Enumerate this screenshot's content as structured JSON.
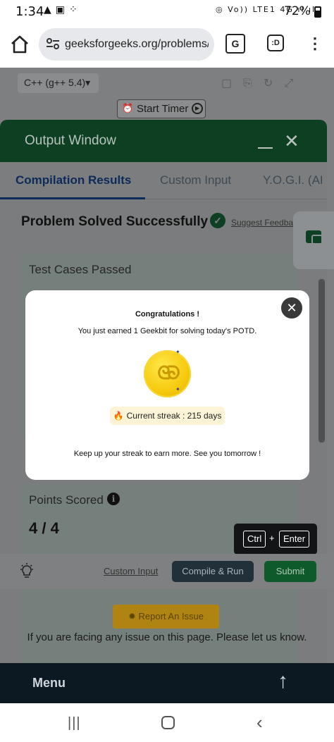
{
  "status_bar": {
    "time": "1:34",
    "battery": "72%",
    "net_label": "Vo)) LTE1 4G"
  },
  "browser": {
    "url": "geeksforgeeks.org/problems/ac",
    "tabs_label": ":D"
  },
  "editor": {
    "language": "C++ (g++ 5.4)▾",
    "timer_label": "Start Timer"
  },
  "output_window": {
    "title": "Output Window",
    "tabs": [
      {
        "label": "Compilation Results"
      },
      {
        "label": "Custom Input"
      },
      {
        "label": "Y.O.G.I. (AI B"
      }
    ],
    "status_title": "Problem Solved Successfully",
    "feedback_link": "Suggest Feedback",
    "test_cases_header": "Test Cases Passed",
    "points_header": "Points Scored",
    "points_value": "4 / 4"
  },
  "actions": {
    "custom_input": "Custom Input",
    "compile_run": "Compile & Run",
    "submit": "Submit",
    "shortcut_key1": "Ctrl",
    "shortcut_plus": "+",
    "shortcut_key2": "Enter"
  },
  "modal": {
    "title": "Congratulations !",
    "message": "You just earned 1 Geekbit for solving today's POTD.",
    "streak": "Current streak : 215 days",
    "footer": "Keep up your streak to earn more. See you tomorrow !"
  },
  "report": {
    "button": "Report An Issue",
    "text": "If you are facing any issue on this page. Please let us know."
  },
  "bottom_menu": {
    "label": "Menu"
  },
  "colors": {
    "gfg_green": "#0f5a2a",
    "navy": "#0c1822",
    "gold": "#f6c90c"
  }
}
